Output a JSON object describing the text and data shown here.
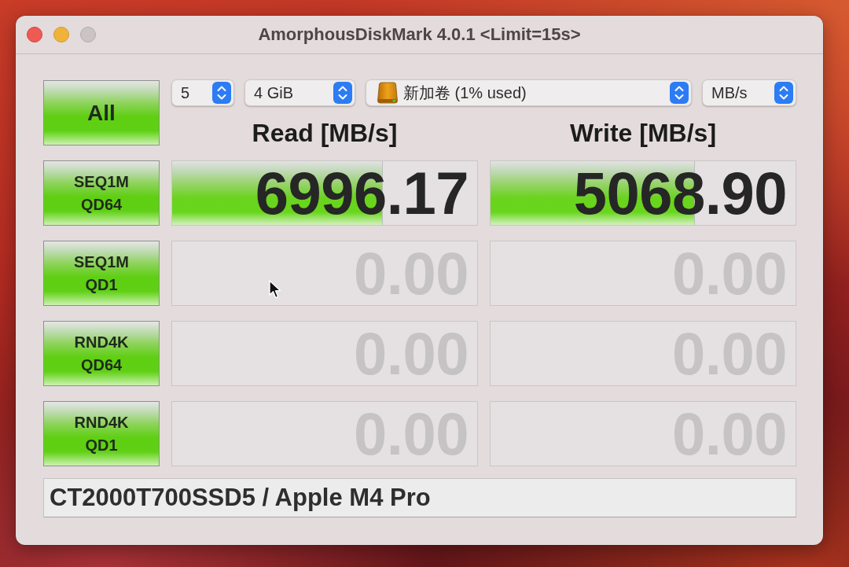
{
  "window": {
    "title": "AmorphousDiskMark 4.0.1 <Limit=15s>"
  },
  "all_button": {
    "label": "All"
  },
  "settings": [
    {
      "kind": "plain",
      "value": "5"
    },
    {
      "kind": "plain",
      "value": "4 GiB"
    },
    {
      "kind": "drive",
      "value": "新加卷 (1% used)"
    },
    {
      "kind": "plain",
      "value": "MB/s"
    }
  ],
  "columns": [
    {
      "label": "Read [MB/s]"
    },
    {
      "label": "Write [MB/s]"
    }
  ],
  "tests": [
    {
      "label": "SEQ1M QD64",
      "read": {
        "reading": "6996.17",
        "measured": true,
        "level": 0.69
      },
      "write": {
        "reading": "5068.90",
        "measured": true,
        "level": 0.67
      }
    },
    {
      "label": "SEQ1M QD1",
      "read": {
        "reading": "0.00",
        "measured": false
      },
      "write": {
        "reading": "0.00",
        "measured": false
      }
    },
    {
      "label": "RND4K QD64",
      "read": {
        "reading": "0.00",
        "measured": false
      },
      "write": {
        "reading": "0.00",
        "measured": false
      }
    },
    {
      "label": "RND4K QD1",
      "read": {
        "reading": "0.00",
        "measured": false
      },
      "write": {
        "reading": "0.00",
        "measured": false
      }
    }
  ],
  "comment": {
    "value": "CT2000T700SSD5 / Apple M4 Pro"
  }
}
